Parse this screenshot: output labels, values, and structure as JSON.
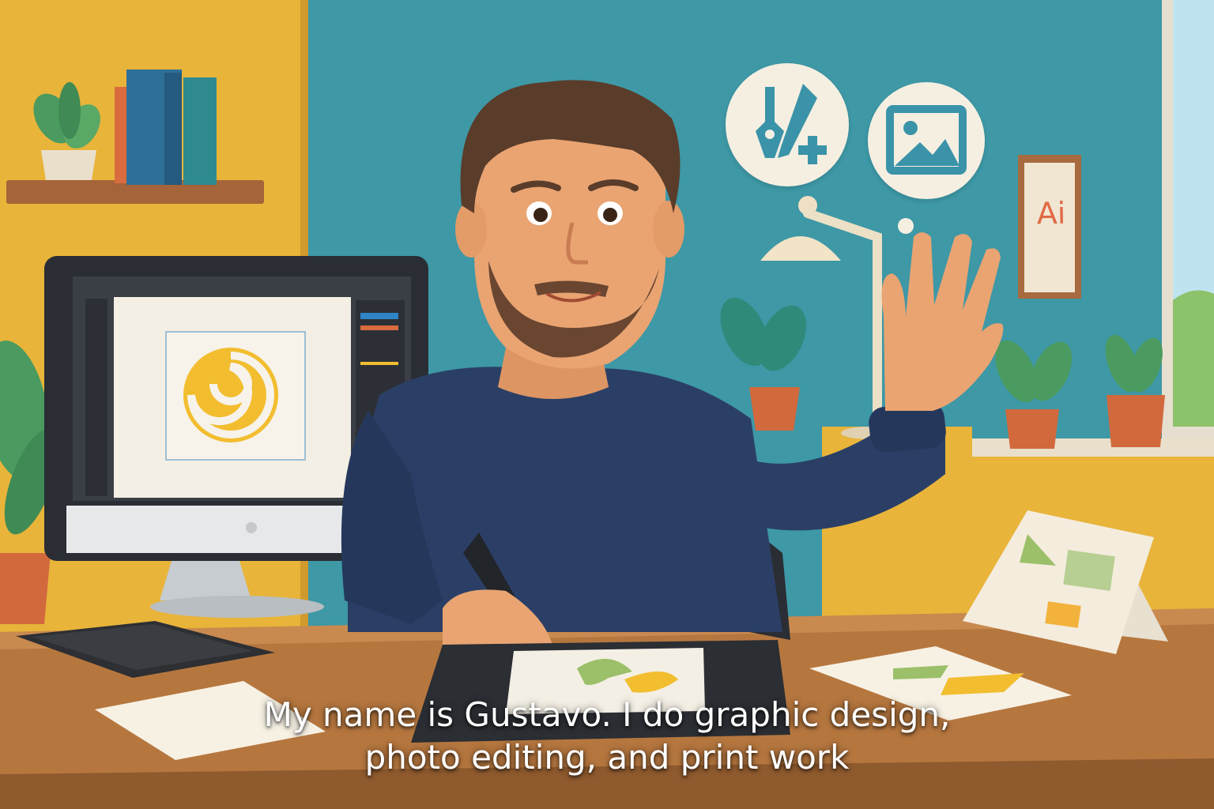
{
  "scene": {
    "subject": "man-waving-at-design-desk",
    "poster": {
      "text": "Ai"
    },
    "bubbles": [
      "design-tools-icon",
      "image-icon"
    ],
    "monitor": {
      "app": "design-app",
      "artwork": "yellow-spiral-logo"
    }
  },
  "caption": {
    "line1": "My name is Gustavo. I do graphic design,",
    "line2": "photo editing, and print work"
  },
  "colors": {
    "wall_teal": "#3e98a6",
    "wall_yellow": "#e8b43a",
    "sweater_navy": "#2b3f66",
    "desk_wood": "#b6773f",
    "skin": "#e9a472",
    "accent_yellow": "#f2bd2f"
  }
}
